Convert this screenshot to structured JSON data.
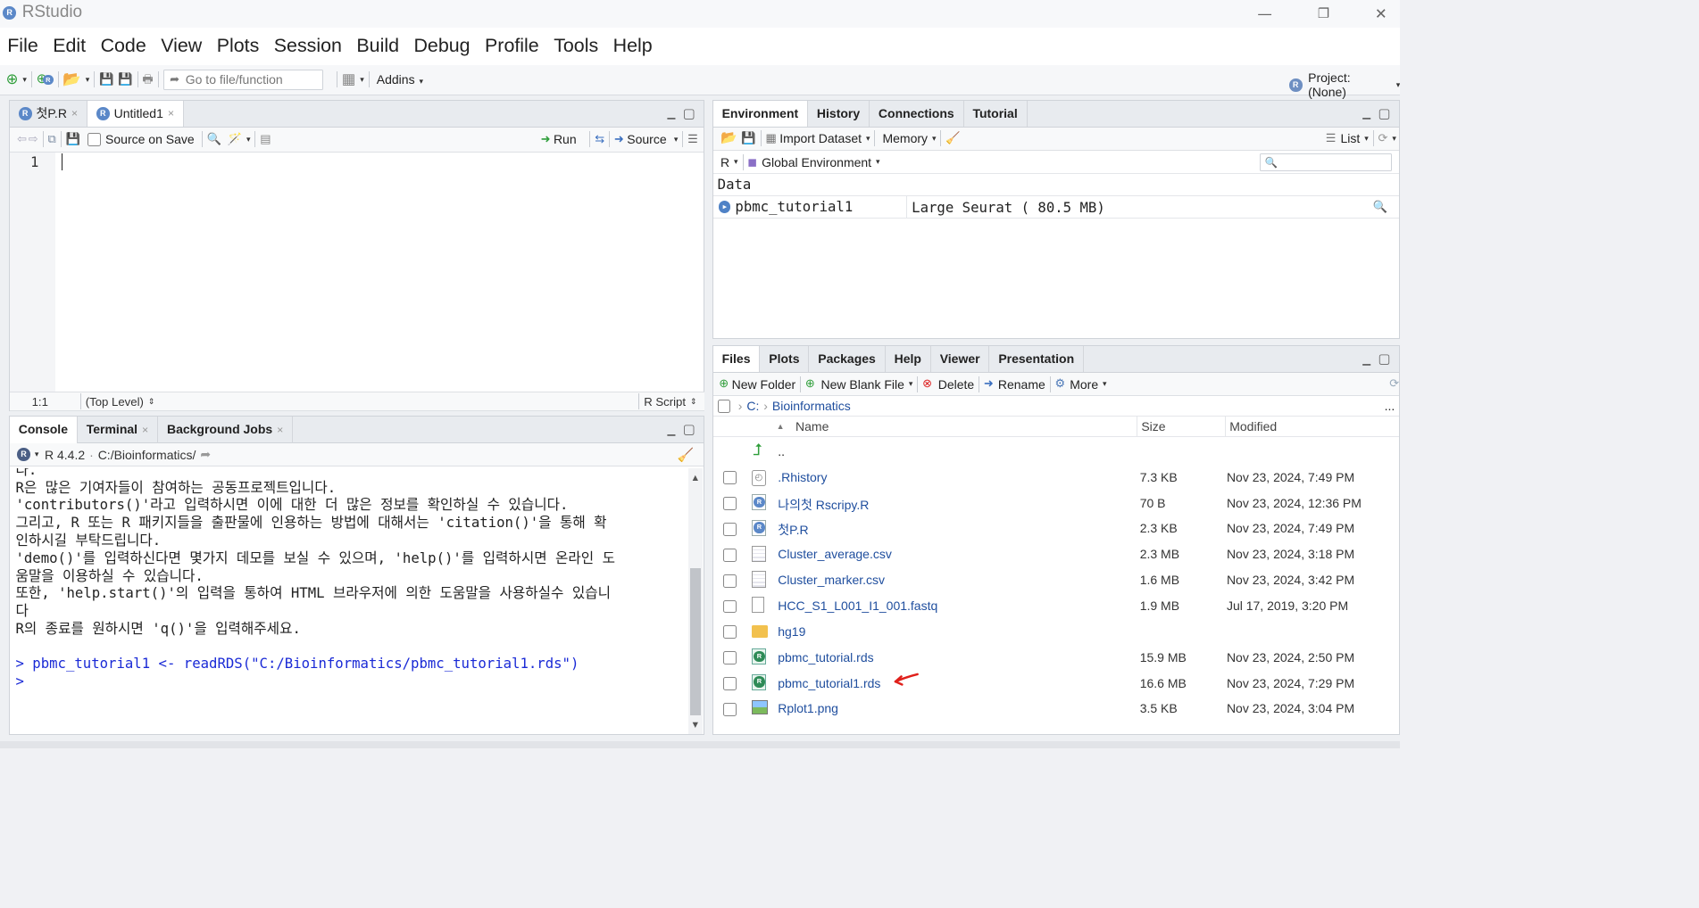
{
  "window": {
    "title": "RStudio",
    "minimize": "—",
    "restore": "❐",
    "close": "✕"
  },
  "menu": [
    "File",
    "Edit",
    "Code",
    "View",
    "Plots",
    "Session",
    "Build",
    "Debug",
    "Profile",
    "Tools",
    "Help"
  ],
  "toolbar": {
    "goto_placeholder": "Go to file/function",
    "addins": "Addins",
    "project": "Project: (None)"
  },
  "editor": {
    "tabs": [
      {
        "label": "첫P.R"
      },
      {
        "label": "Untitled1"
      }
    ],
    "source_on_save": "Source on Save",
    "run": "Run",
    "source": "Source",
    "line_number": "1",
    "status_position": "1:1",
    "status_scope": "(Top Level)",
    "status_type": "R Script"
  },
  "console": {
    "tabs": [
      "Console",
      "Terminal",
      "Background Jobs"
    ],
    "r_version": "R 4.4.2",
    "path": "C:/Bioinformatics/",
    "lines": [
      "다.",
      "",
      "R은 많은 기여자들이 참여하는 공동프로젝트입니다.",
      "'contributors()'라고 입력하시면 이에 대한 더 많은 정보를 확인하실 수 있습니다.",
      "그리고, R 또는 R 패키지들을 출판물에 인용하는 방법에 대해서는 'citation()'을 통해 확",
      "인하시길 부탁드립니다.",
      "",
      "'demo()'를 입력하신다면 몇가지 데모를 보실 수 있으며, 'help()'를 입력하시면 온라인 도",
      "움말을 이용하실 수 있습니다.",
      "또한, 'help.start()'의 입력을 통하여 HTML 브라우저에 의한 도움말을 사용하실수 있습니",
      "다",
      "R의 종료를 원하시면 'q()'을 입력해주세요."
    ],
    "command": "> pbmc_tutorial1 <- readRDS(\"C:/Bioinformatics/pbmc_tutorial1.rds\")",
    "prompt": ">"
  },
  "environment": {
    "tabs": [
      "Environment",
      "History",
      "Connections",
      "Tutorial"
    ],
    "import_dataset": "Import Dataset",
    "memory": "Memory",
    "list": "List",
    "lang": "R",
    "scope": "Global Environment",
    "section": "Data",
    "items": [
      {
        "name": "pbmc_tutorial1",
        "value": "Large Seurat ( 80.5 MB)"
      }
    ]
  },
  "files": {
    "tabs": [
      "Files",
      "Plots",
      "Packages",
      "Help",
      "Viewer",
      "Presentation"
    ],
    "new_folder": "New Folder",
    "new_blank_file": "New Blank File",
    "delete": "Delete",
    "rename": "Rename",
    "more": "More",
    "breadcrumb_root": "C:",
    "breadcrumb_dir": "Bioinformatics",
    "ellipsis": "...",
    "col_name": "Name",
    "col_size": "Size",
    "col_modified": "Modified",
    "parent": "..",
    "rows": [
      {
        "name": ".Rhistory",
        "size": "7.3 KB",
        "modified": "Nov 23, 2024, 7:49 PM",
        "icon": "history-file-icon"
      },
      {
        "name": "나의첫 Rscripy.R",
        "size": "70 B",
        "modified": "Nov 23, 2024, 12:36 PM",
        "icon": "r-script-icon"
      },
      {
        "name": "첫P.R",
        "size": "2.3 KB",
        "modified": "Nov 23, 2024, 7:49 PM",
        "icon": "r-script-icon"
      },
      {
        "name": "Cluster_average.csv",
        "size": "2.3 MB",
        "modified": "Nov 23, 2024, 3:18 PM",
        "icon": "csv-icon"
      },
      {
        "name": "Cluster_marker.csv",
        "size": "1.6 MB",
        "modified": "Nov 23, 2024, 3:42 PM",
        "icon": "csv-icon"
      },
      {
        "name": "HCC_S1_L001_I1_001.fastq",
        "size": "1.9 MB",
        "modified": "Jul 17, 2019, 3:20 PM",
        "icon": "blank-file-icon"
      },
      {
        "name": "hg19",
        "size": "",
        "modified": "",
        "icon": "folder-icon"
      },
      {
        "name": "pbmc_tutorial.rds",
        "size": "15.9 MB",
        "modified": "Nov 23, 2024, 2:50 PM",
        "icon": "rds-icon"
      },
      {
        "name": "pbmc_tutorial1.rds",
        "size": "16.6 MB",
        "modified": "Nov 23, 2024, 7:29 PM",
        "icon": "rds-icon"
      },
      {
        "name": "Rplot1.png",
        "size": "3.5 KB",
        "modified": "Nov 23, 2024, 3:04 PM",
        "icon": "image-icon"
      }
    ]
  },
  "colors": {
    "accent": "#1f4e9e",
    "annotation_arrow": "#e0201b",
    "tab_bg": "#e8ebef"
  }
}
